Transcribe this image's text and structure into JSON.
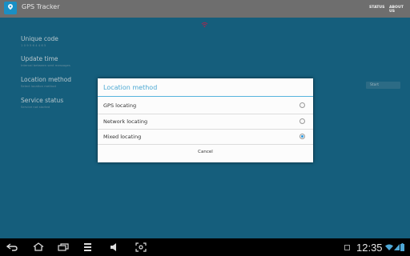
{
  "app": {
    "title": "GPS Tracker",
    "icon": "map-pin-icon",
    "accent": "#1a8fc4"
  },
  "menu": {
    "status": "STATUS",
    "about": "ABOUT US"
  },
  "preferences": [
    {
      "title": "Unique code",
      "summary": "1 0 9 5 6 4 4 6 5"
    },
    {
      "title": "Update time",
      "summary": "Interval between sent messages"
    },
    {
      "title": "Location method",
      "summary": "Select location method"
    },
    {
      "title": "Service status",
      "summary": "Service not started"
    }
  ],
  "service_button": {
    "label": "Start"
  },
  "dialog": {
    "title": "Location method",
    "options": [
      {
        "label": "GPS locating",
        "selected": false
      },
      {
        "label": "Network locating",
        "selected": false
      },
      {
        "label": "Mixed locating",
        "selected": true
      }
    ],
    "cancel_label": "Cancel"
  },
  "statusbar": {
    "time": "12:35"
  },
  "icons": {
    "back": "back-icon",
    "home": "home-icon",
    "recents": "recent-apps-icon",
    "screenshot": "screenshot-icon",
    "wifi": "wifi-icon",
    "battery": "battery-icon"
  }
}
